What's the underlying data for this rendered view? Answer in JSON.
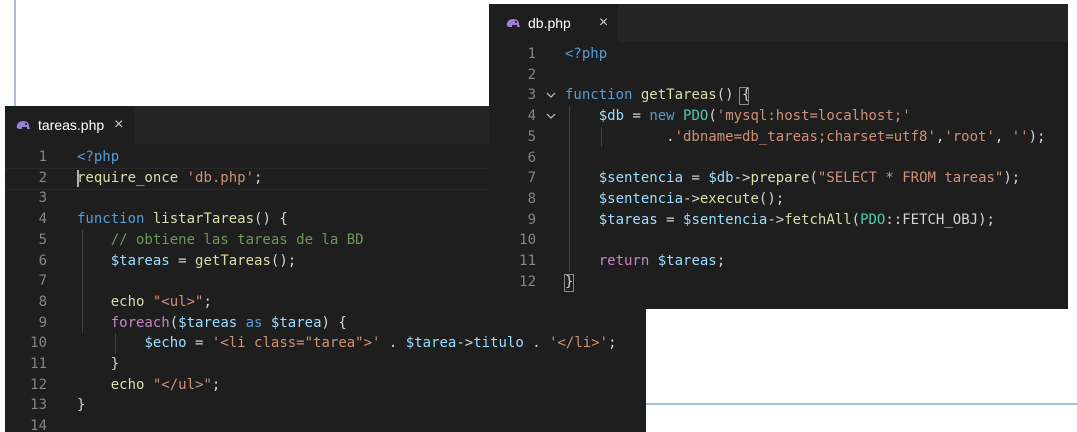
{
  "left_editor": {
    "tab": {
      "filename": "tareas.php",
      "close_glyph": "×",
      "icon": "php-elephant-icon"
    },
    "lines": [
      {
        "n": "1",
        "segs": [
          [
            "k",
            "<?php"
          ]
        ]
      },
      {
        "n": "2",
        "segs": [
          [
            "fn",
            "require_once"
          ],
          [
            "t",
            " "
          ],
          [
            "str",
            "'db.php'"
          ],
          [
            "t",
            ";"
          ]
        ]
      },
      {
        "n": "3",
        "segs": []
      },
      {
        "n": "4",
        "segs": [
          [
            "k",
            "function"
          ],
          [
            "t",
            " "
          ],
          [
            "fn",
            "listarTareas"
          ],
          [
            "t",
            "() {"
          ]
        ]
      },
      {
        "n": "5",
        "segs": [
          [
            "t",
            "    "
          ],
          [
            "cmt",
            "// obtiene las tareas de la BD"
          ]
        ]
      },
      {
        "n": "6",
        "segs": [
          [
            "t",
            "    "
          ],
          [
            "var",
            "$tareas"
          ],
          [
            "t",
            " = "
          ],
          [
            "fn",
            "getTareas"
          ],
          [
            "t",
            "();"
          ]
        ]
      },
      {
        "n": "7",
        "segs": []
      },
      {
        "n": "8",
        "segs": [
          [
            "t",
            "    "
          ],
          [
            "fn",
            "echo"
          ],
          [
            "t",
            " "
          ],
          [
            "str",
            "\"<ul>\""
          ],
          [
            "t",
            ";"
          ]
        ]
      },
      {
        "n": "9",
        "segs": [
          [
            "t",
            "    "
          ],
          [
            "ctl",
            "foreach"
          ],
          [
            "t",
            "("
          ],
          [
            "var",
            "$tareas"
          ],
          [
            "t",
            " "
          ],
          [
            "k",
            "as"
          ],
          [
            "t",
            " "
          ],
          [
            "var",
            "$tarea"
          ],
          [
            "t",
            ") {"
          ]
        ]
      },
      {
        "n": "10",
        "segs": [
          [
            "t",
            "        "
          ],
          [
            "var",
            "$echo"
          ],
          [
            "t",
            " = "
          ],
          [
            "str",
            "'<li class=\"tarea\">'"
          ],
          [
            "t",
            " . "
          ],
          [
            "var",
            "$tarea"
          ],
          [
            "t",
            "->"
          ],
          [
            "var",
            "titulo"
          ],
          [
            "t",
            " . "
          ],
          [
            "str",
            "'</li>'"
          ],
          [
            "t",
            ";"
          ]
        ]
      },
      {
        "n": "11",
        "segs": [
          [
            "t",
            "    }"
          ]
        ]
      },
      {
        "n": "12",
        "segs": [
          [
            "t",
            "    "
          ],
          [
            "fn",
            "echo"
          ],
          [
            "t",
            " "
          ],
          [
            "str",
            "\"</ul>\""
          ],
          [
            "t",
            ";"
          ]
        ]
      },
      {
        "n": "13",
        "segs": [
          [
            "t",
            "}"
          ]
        ]
      },
      {
        "n": "14",
        "segs": []
      }
    ]
  },
  "right_editor": {
    "tab": {
      "filename": "db.php",
      "close_glyph": "×",
      "icon": "php-elephant-icon"
    },
    "lines": [
      {
        "n": "1",
        "segs": [
          [
            "k",
            "<?php"
          ]
        ]
      },
      {
        "n": "2",
        "segs": []
      },
      {
        "n": "3",
        "segs": [
          [
            "k",
            "function"
          ],
          [
            "t",
            " "
          ],
          [
            "fn",
            "getTareas"
          ],
          [
            "t",
            "() {"
          ]
        ]
      },
      {
        "n": "4",
        "segs": [
          [
            "t",
            "    "
          ],
          [
            "var",
            "$db"
          ],
          [
            "t",
            " = "
          ],
          [
            "k",
            "new"
          ],
          [
            "t",
            " "
          ],
          [
            "cls",
            "PDO"
          ],
          [
            "t",
            "("
          ],
          [
            "str",
            "'mysql:host=localhost;'"
          ]
        ]
      },
      {
        "n": "5",
        "segs": [
          [
            "t",
            "            ."
          ],
          [
            "str",
            "'dbname=db_tareas;charset=utf8'"
          ],
          [
            "t",
            ","
          ],
          [
            "str",
            "'root'"
          ],
          [
            "t",
            ", "
          ],
          [
            "str",
            "''"
          ],
          [
            "t",
            ");"
          ]
        ]
      },
      {
        "n": "6",
        "segs": []
      },
      {
        "n": "7",
        "segs": [
          [
            "t",
            "    "
          ],
          [
            "var",
            "$sentencia"
          ],
          [
            "t",
            " = "
          ],
          [
            "var",
            "$db"
          ],
          [
            "t",
            "->"
          ],
          [
            "fn",
            "prepare"
          ],
          [
            "t",
            "("
          ],
          [
            "str",
            "\"SELECT * FROM tareas\""
          ],
          [
            "t",
            ");"
          ]
        ]
      },
      {
        "n": "8",
        "segs": [
          [
            "t",
            "    "
          ],
          [
            "var",
            "$sentencia"
          ],
          [
            "t",
            "->"
          ],
          [
            "fn",
            "execute"
          ],
          [
            "t",
            "();"
          ]
        ]
      },
      {
        "n": "9",
        "segs": [
          [
            "t",
            "    "
          ],
          [
            "var",
            "$tareas"
          ],
          [
            "t",
            " = "
          ],
          [
            "var",
            "$sentencia"
          ],
          [
            "t",
            "->"
          ],
          [
            "fn",
            "fetchAll"
          ],
          [
            "t",
            "("
          ],
          [
            "cls",
            "PDO"
          ],
          [
            "t",
            "::FETCH_OBJ);"
          ]
        ]
      },
      {
        "n": "10",
        "segs": []
      },
      {
        "n": "11",
        "segs": [
          [
            "t",
            "    "
          ],
          [
            "ctl",
            "return"
          ],
          [
            "t",
            " "
          ],
          [
            "var",
            "$tareas"
          ],
          [
            "t",
            ";"
          ]
        ]
      },
      {
        "n": "12",
        "segs": [
          [
            "t",
            "}"
          ]
        ]
      }
    ]
  },
  "colors": {
    "editor_bg": "#1e1e1e",
    "tab_bar_bg": "#252526",
    "keyword": "#569cd6",
    "control": "#c586c0",
    "function": "#dcdcaa",
    "variable": "#9cdcfe",
    "string": "#ce9178",
    "comment": "#6a9955",
    "class": "#4ec9b0",
    "elephant": "#9b7fd4"
  }
}
